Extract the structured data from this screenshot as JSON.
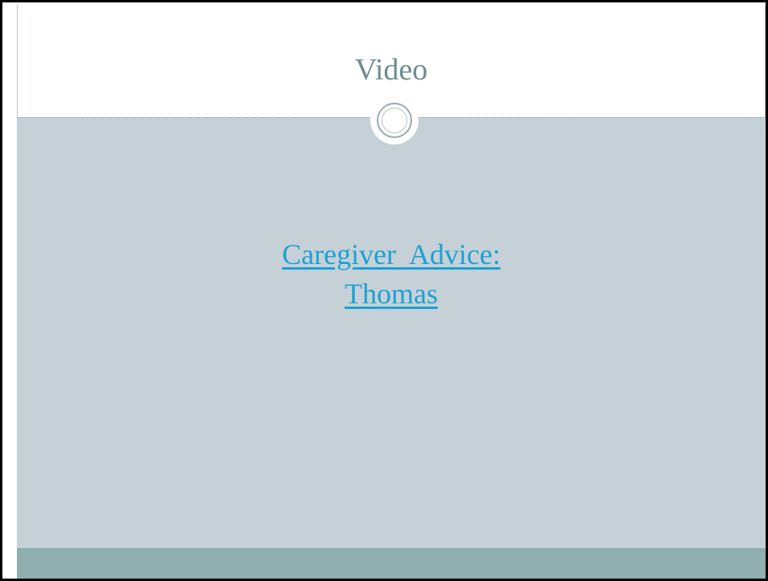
{
  "slide": {
    "title": "Video",
    "link": {
      "line1": "Caregiver  Advice:",
      "line2": "Thomas"
    }
  },
  "colors": {
    "title": "#6f8c90",
    "content_background": "#c6d1d7",
    "footer_bar": "#8eaeb0",
    "link": "#1ba1d4"
  },
  "icons": {
    "ornament": "double-ring-circle-icon"
  }
}
